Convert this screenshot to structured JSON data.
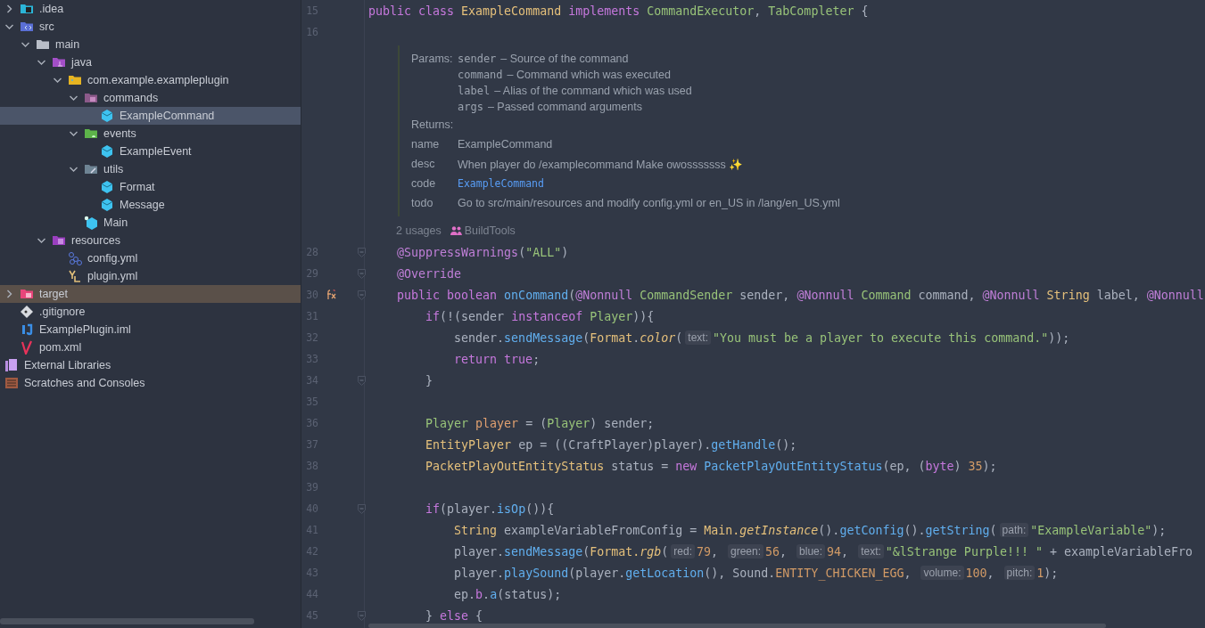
{
  "tree": {
    "items": [
      {
        "label": ".idea",
        "kind": "idea-folder",
        "expanded": false,
        "selected": false,
        "excluded": false
      },
      {
        "label": "src",
        "kind": "source-folder",
        "expanded": true,
        "selected": false,
        "excluded": false,
        "children": [
          {
            "label": "main",
            "kind": "folder",
            "expanded": true,
            "selected": false,
            "excluded": false,
            "children": [
              {
                "label": "java",
                "kind": "java-root",
                "expanded": true,
                "selected": false,
                "excluded": false,
                "children": [
                  {
                    "label": "com.example.exampleplugin",
                    "kind": "package",
                    "expanded": true,
                    "selected": false,
                    "excluded": false,
                    "children": [
                      {
                        "label": "commands",
                        "kind": "commands-package",
                        "expanded": true,
                        "selected": false,
                        "excluded": false,
                        "children": [
                          {
                            "label": "ExampleCommand",
                            "kind": "class",
                            "selected": true,
                            "excluded": false
                          }
                        ]
                      },
                      {
                        "label": "events",
                        "kind": "events-package",
                        "expanded": true,
                        "selected": false,
                        "excluded": false,
                        "children": [
                          {
                            "label": "ExampleEvent",
                            "kind": "class",
                            "selected": false,
                            "excluded": false
                          }
                        ]
                      },
                      {
                        "label": "utils",
                        "kind": "utils-package",
                        "expanded": true,
                        "selected": false,
                        "excluded": false,
                        "children": [
                          {
                            "label": "Format",
                            "kind": "class",
                            "selected": false,
                            "excluded": false
                          },
                          {
                            "label": "Message",
                            "kind": "class",
                            "selected": false,
                            "excluded": false
                          }
                        ]
                      },
                      {
                        "label": "Main",
                        "kind": "main-class",
                        "selected": false,
                        "excluded": false
                      }
                    ]
                  }
                ]
              },
              {
                "label": "resources",
                "kind": "resources-folder",
                "expanded": true,
                "selected": false,
                "excluded": false,
                "children": [
                  {
                    "label": "config.yml",
                    "kind": "config-file",
                    "selected": false,
                    "excluded": false
                  },
                  {
                    "label": "plugin.yml",
                    "kind": "yaml-file",
                    "selected": false,
                    "excluded": false
                  }
                ]
              }
            ]
          }
        ]
      },
      {
        "label": "target",
        "kind": "excluded-folder",
        "expanded": false,
        "selected": false,
        "excluded": true
      },
      {
        "label": ".gitignore",
        "kind": "gitignore",
        "selected": false,
        "excluded": false
      },
      {
        "label": "ExamplePlugin.iml",
        "kind": "iml-file",
        "selected": false,
        "excluded": false
      },
      {
        "label": "pom.xml",
        "kind": "maven-file",
        "selected": false,
        "excluded": false
      }
    ],
    "extras": [
      {
        "label": "External Libraries",
        "kind": "libraries",
        "selected": false
      },
      {
        "label": "Scratches and Consoles",
        "kind": "scratches",
        "selected": false
      }
    ]
  },
  "editor": {
    "lines_before": [
      {
        "number": "15",
        "fold": false,
        "tokens": [
          {
            "kind": "kw",
            "text": "public class "
          },
          {
            "kind": "cls",
            "text": "ExampleCommand "
          },
          {
            "kind": "kw",
            "text": "implements "
          },
          {
            "kind": "ifc",
            "text": "CommandExecutor"
          },
          {
            "kind": "p",
            "text": ", "
          },
          {
            "kind": "ifc",
            "text": "TabCompleter "
          },
          {
            "kind": "p",
            "text": "{"
          }
        ]
      },
      {
        "number": "16",
        "fold": false
      }
    ],
    "doc": {
      "params_label": "Params:",
      "params": [
        {
          "name": "sender",
          "text": "– Source of the command"
        },
        {
          "name": "command",
          "text": "– Command which was executed"
        },
        {
          "name": "label",
          "text": "– Alias of the command which was used"
        },
        {
          "name": "args",
          "text": "– Passed command arguments"
        }
      ],
      "returns_label": "Returns:",
      "tags": [
        {
          "label": "name",
          "kind": "text",
          "value": "ExampleCommand"
        },
        {
          "label": "desc",
          "kind": "text",
          "value": "When player do /examplecommand Make owosssssss ✨"
        },
        {
          "label": "code",
          "kind": "code",
          "value": "ExampleCommand"
        },
        {
          "label": "todo",
          "kind": "text",
          "value": "Go to src/main/resources and modify config.yml or en_US in /lang/en_US.yml"
        }
      ]
    },
    "usages": {
      "count": "2 usages",
      "author": "BuildTools"
    },
    "lines": [
      {
        "number": "28",
        "fold": true,
        "tokens": [
          {
            "kind": "ann",
            "text": "    @SuppressWarnings"
          },
          {
            "kind": "p",
            "text": "("
          },
          {
            "kind": "str",
            "text": "\"ALL\""
          },
          {
            "kind": "p",
            "text": ")"
          }
        ]
      },
      {
        "number": "29",
        "fold": true,
        "tokens": [
          {
            "kind": "ann",
            "text": "    @Override"
          }
        ]
      },
      {
        "number": "30",
        "fold": true,
        "marker": {
          "kind": "implements"
        },
        "tokens": [
          {
            "kind": "kw",
            "text": "    public boolean "
          },
          {
            "kind": "fn",
            "text": "onCommand"
          },
          {
            "kind": "p",
            "text": "("
          },
          {
            "kind": "ann",
            "text": "@Nonnull "
          },
          {
            "kind": "ifc",
            "text": "CommandSender "
          },
          {
            "kind": "p",
            "text": "sender, "
          },
          {
            "kind": "ann",
            "text": "@Nonnull "
          },
          {
            "kind": "ifc",
            "text": "Command "
          },
          {
            "kind": "p",
            "text": "command, "
          },
          {
            "kind": "ann",
            "text": "@Nonnull "
          },
          {
            "kind": "cls",
            "text": "String "
          },
          {
            "kind": "p",
            "text": "label, "
          },
          {
            "kind": "ann",
            "text": "@Nonnull"
          }
        ]
      },
      {
        "number": "31",
        "fold": false,
        "tokens": [
          {
            "kind": "kw",
            "text": "        if"
          },
          {
            "kind": "p",
            "text": "(!(sender "
          },
          {
            "kind": "kw",
            "text": "instanceof "
          },
          {
            "kind": "ifc",
            "text": "Player"
          },
          {
            "kind": "p",
            "text": ")){"
          }
        ]
      },
      {
        "number": "32",
        "fold": false,
        "tokens": [
          {
            "kind": "p",
            "text": "            sender."
          },
          {
            "kind": "fn",
            "text": "sendMessage"
          },
          {
            "kind": "p",
            "text": "("
          },
          {
            "kind": "cls",
            "text": "Format"
          },
          {
            "kind": "p",
            "text": "."
          },
          {
            "kind": "sfn",
            "text": "color"
          },
          {
            "kind": "p",
            "text": "("
          },
          {
            "kind": "hint",
            "text": "text:"
          },
          {
            "kind": "str",
            "text": "\"You must be a player to execute this command.\""
          },
          {
            "kind": "p",
            "text": "));"
          }
        ]
      },
      {
        "number": "33",
        "fold": false,
        "tokens": [
          {
            "kind": "kw",
            "text": "            return true"
          },
          {
            "kind": "p",
            "text": ";"
          }
        ]
      },
      {
        "number": "34",
        "fold": true,
        "tokens": [
          {
            "kind": "p",
            "text": "        }"
          }
        ]
      },
      {
        "number": "35",
        "fold": false
      },
      {
        "number": "36",
        "fold": false,
        "tokens": [
          {
            "kind": "ifc",
            "text": "        Player "
          },
          {
            "kind": "var",
            "text": "player "
          },
          {
            "kind": "p",
            "text": "= ("
          },
          {
            "kind": "ifc",
            "text": "Player"
          },
          {
            "kind": "p",
            "text": ") sender;"
          }
        ]
      },
      {
        "number": "37",
        "fold": false,
        "tokens": [
          {
            "kind": "cls",
            "text": "        EntityPlayer "
          },
          {
            "kind": "p",
            "text": "ep = ((CraftPlayer)player)."
          },
          {
            "kind": "fn",
            "text": "getHandle"
          },
          {
            "kind": "p",
            "text": "();"
          }
        ]
      },
      {
        "number": "38",
        "fold": false,
        "tokens": [
          {
            "kind": "cls",
            "text": "        PacketPlayOutEntityStatus "
          },
          {
            "kind": "p",
            "text": "status = "
          },
          {
            "kind": "kw",
            "text": "new "
          },
          {
            "kind": "fn",
            "text": "PacketPlayOutEntityStatus"
          },
          {
            "kind": "p",
            "text": "(ep, ("
          },
          {
            "kind": "kw",
            "text": "byte"
          },
          {
            "kind": "p",
            "text": ") "
          },
          {
            "kind": "num",
            "text": "35"
          },
          {
            "kind": "p",
            "text": ");"
          }
        ]
      },
      {
        "number": "39",
        "fold": false
      },
      {
        "number": "40",
        "fold": true,
        "tokens": [
          {
            "kind": "kw",
            "text": "        if"
          },
          {
            "kind": "p",
            "text": "(player."
          },
          {
            "kind": "fn",
            "text": "isOp"
          },
          {
            "kind": "p",
            "text": "()){"
          }
        ]
      },
      {
        "number": "41",
        "fold": false,
        "tokens": [
          {
            "kind": "cls",
            "text": "            String "
          },
          {
            "kind": "p",
            "text": "exampleVariableFromConfig = "
          },
          {
            "kind": "cls",
            "text": "Main."
          },
          {
            "kind": "sfn",
            "text": "getInstance"
          },
          {
            "kind": "p",
            "text": "()."
          },
          {
            "kind": "fn",
            "text": "getConfig"
          },
          {
            "kind": "p",
            "text": "()."
          },
          {
            "kind": "fn",
            "text": "getString"
          },
          {
            "kind": "p",
            "text": "("
          },
          {
            "kind": "hint",
            "text": "path:"
          },
          {
            "kind": "str",
            "text": "\"ExampleVariable\""
          },
          {
            "kind": "p",
            "text": ");"
          }
        ]
      },
      {
        "number": "42",
        "fold": false,
        "tokens": [
          {
            "kind": "p",
            "text": "            player."
          },
          {
            "kind": "fn",
            "text": "sendMessage"
          },
          {
            "kind": "p",
            "text": "("
          },
          {
            "kind": "cls",
            "text": "Format."
          },
          {
            "kind": "sfn",
            "text": "rgb"
          },
          {
            "kind": "p",
            "text": "("
          },
          {
            "kind": "hint",
            "text": "red:"
          },
          {
            "kind": "num",
            "text": "79"
          },
          {
            "kind": "p",
            "text": ", "
          },
          {
            "kind": "hint",
            "text": "green:"
          },
          {
            "kind": "num",
            "text": "56"
          },
          {
            "kind": "p",
            "text": ", "
          },
          {
            "kind": "hint",
            "text": "blue:"
          },
          {
            "kind": "num",
            "text": "94"
          },
          {
            "kind": "p",
            "text": ", "
          },
          {
            "kind": "hint",
            "text": "text:"
          },
          {
            "kind": "str",
            "text": "\"&lStrange Purple!!! \""
          },
          {
            "kind": "p",
            "text": " + exampleVariableFro"
          }
        ]
      },
      {
        "number": "43",
        "fold": false,
        "tokens": [
          {
            "kind": "p",
            "text": "            player."
          },
          {
            "kind": "fn",
            "text": "playSound"
          },
          {
            "kind": "p",
            "text": "(player."
          },
          {
            "kind": "fn",
            "text": "getLocation"
          },
          {
            "kind": "p",
            "text": "(), Sound."
          },
          {
            "kind": "cst",
            "text": "ENTITY_CHICKEN_EGG"
          },
          {
            "kind": "p",
            "text": ", "
          },
          {
            "kind": "hint",
            "text": "volume:"
          },
          {
            "kind": "num",
            "text": "100"
          },
          {
            "kind": "p",
            "text": ", "
          },
          {
            "kind": "hint",
            "text": "pitch:"
          },
          {
            "kind": "num",
            "text": "1"
          },
          {
            "kind": "p",
            "text": ");"
          }
        ]
      },
      {
        "number": "44",
        "fold": false,
        "tokens": [
          {
            "kind": "p",
            "text": "            ep."
          },
          {
            "kind": "fld",
            "text": "b"
          },
          {
            "kind": "p",
            "text": "."
          },
          {
            "kind": "fn",
            "text": "a"
          },
          {
            "kind": "p",
            "text": "(status);"
          }
        ]
      },
      {
        "number": "45",
        "fold": true,
        "tokens": [
          {
            "kind": "p",
            "text": "        } "
          },
          {
            "kind": "kw",
            "text": "else "
          },
          {
            "kind": "p",
            "text": "{"
          }
        ]
      }
    ]
  }
}
